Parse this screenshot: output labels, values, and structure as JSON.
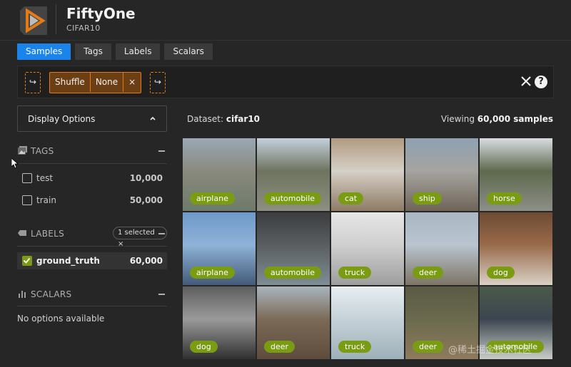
{
  "app": {
    "title": "FiftyOne",
    "subtitle": "CIFAR10"
  },
  "tabs": [
    {
      "label": "Samples",
      "active": true
    },
    {
      "label": "Tags",
      "active": false
    },
    {
      "label": "Labels",
      "active": false
    },
    {
      "label": "Scalars",
      "active": false
    }
  ],
  "filterbar": {
    "left_icon": "↪",
    "stage": {
      "name": "Shuffle",
      "param": "None",
      "remove": "×"
    },
    "right_icon": "↪",
    "help": "?"
  },
  "sidebar": {
    "display_options": "Display Options",
    "tags": {
      "heading": "TAGS",
      "items": [
        {
          "name": "test",
          "count": "10,000"
        },
        {
          "name": "train",
          "count": "50,000"
        }
      ]
    },
    "labels": {
      "heading": "LABELS",
      "selected_pill": "1 selected ×",
      "items": [
        {
          "name": "ground_truth",
          "count": "60,000",
          "checked": true
        }
      ]
    },
    "scalars": {
      "heading": "SCALARS",
      "empty": "No options available"
    }
  },
  "main": {
    "dataset_prefix": "Dataset: ",
    "dataset_name": "cifar10",
    "viewing_prefix": "Viewing ",
    "viewing_count": "60,000 samples"
  },
  "samples": [
    {
      "label": "airplane",
      "colors": [
        "#9aa7b5",
        "#6d7a6a",
        "#8a8a7e"
      ]
    },
    {
      "label": "automobile",
      "colors": [
        "#c4d0dc",
        "#8d8f80",
        "#6e7460"
      ]
    },
    {
      "label": "cat",
      "colors": [
        "#b09a82",
        "#8d7b66",
        "#d6d0c6"
      ]
    },
    {
      "label": "ship",
      "colors": [
        "#8fa1b0",
        "#6f6458",
        "#a5a4a0"
      ]
    },
    {
      "label": "horse",
      "colors": [
        "#d8dce2",
        "#8d8f86",
        "#5e6a4e"
      ]
    },
    {
      "label": "airplane",
      "colors": [
        "#6f99c9",
        "#445a78",
        "#8fb2d8"
      ]
    },
    {
      "label": "automobile",
      "colors": [
        "#3b3d3f",
        "#7f8d95",
        "#5a5e60"
      ]
    },
    {
      "label": "truck",
      "colors": [
        "#e6e6e6",
        "#9e9e9e",
        "#cfcfcf"
      ]
    },
    {
      "label": "deer",
      "colors": [
        "#aab7c3",
        "#7d7466",
        "#b9c4cf"
      ]
    },
    {
      "label": "dog",
      "colors": [
        "#6d4a33",
        "#d9d0c5",
        "#9a6b4b"
      ]
    },
    {
      "label": "dog",
      "colors": [
        "#5e5e5e",
        "#2f2f2f",
        "#9a9a9a"
      ]
    },
    {
      "label": "deer",
      "colors": [
        "#a9b5bd",
        "#5d4b3d",
        "#7c6a58"
      ]
    },
    {
      "label": "truck",
      "colors": [
        "#e8eef2",
        "#9fb0b8",
        "#c5d1d8"
      ]
    },
    {
      "label": "deer",
      "colors": [
        "#5b5a45",
        "#8f7a5c",
        "#6b6a4e"
      ]
    },
    {
      "label": "automobile",
      "colors": [
        "#4a5a4a",
        "#c9cdc8",
        "#3c4650"
      ]
    }
  ],
  "watermark": "@稀土掘金技术社区",
  "colors": {
    "accent": "#1b84ea",
    "stage_orange": "#e57b12",
    "label_green": "#7a9c12"
  }
}
